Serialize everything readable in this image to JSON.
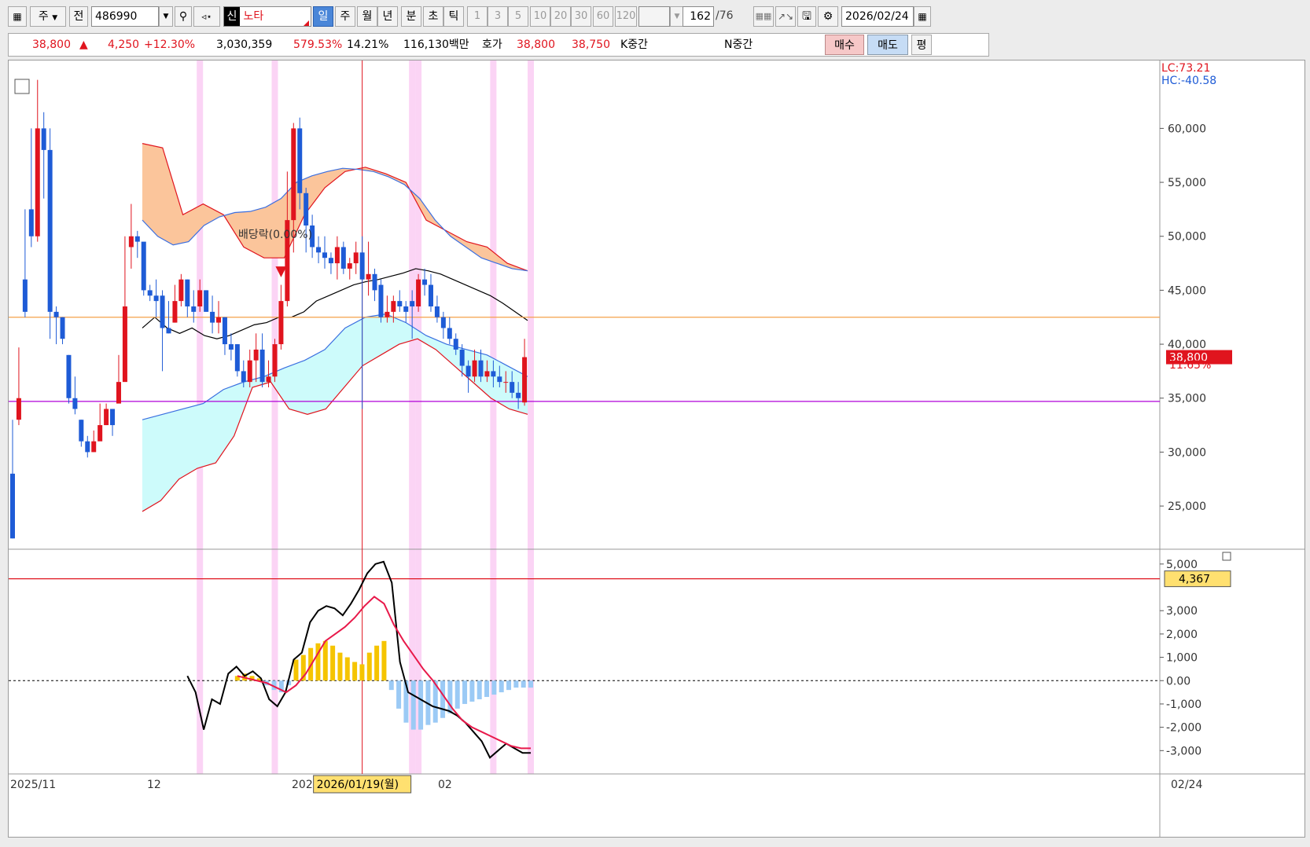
{
  "toolbar": {
    "market_type": "주",
    "market_mode": "전",
    "code": "486990",
    "credit_badge": "신",
    "stock_name": "노타",
    "period_buttons": [
      "일",
      "주",
      "월",
      "년",
      "분",
      "초",
      "틱"
    ],
    "active_period": "일",
    "minute_buttons": [
      "1",
      "3",
      "5",
      "10",
      "20",
      "30",
      "60",
      "120"
    ],
    "count": "162",
    "count_total": "/76",
    "date": "2026/02/24"
  },
  "quote": {
    "price": "38,800",
    "arrow": "▲",
    "change": "4,250",
    "change_pct": "+12.30%",
    "volume": "3,030,359",
    "volume_ratio": "579.53%",
    "turnover": "14.21%",
    "amount": "116,130백만",
    "hoga_label": "호가",
    "ask": "38,800",
    "bid": "38,750",
    "k_label": "K중간",
    "n_label": "N중간",
    "buy_label": "매수",
    "sell_label": "매도",
    "eval_label": "평"
  },
  "chart_data": [
    {
      "type": "candlestick",
      "title": "",
      "ylim": [
        21000,
        66000
      ],
      "y_ticks": [
        25000,
        30000,
        35000,
        40000,
        45000,
        50000,
        55000,
        60000
      ],
      "y_tick_labels": [
        "25,000",
        "30,000",
        "35,000",
        "40,000",
        "45,000",
        "50,000",
        "55,000",
        "60,000"
      ],
      "x_labels": [
        "2025/11",
        "12",
        "2026/01",
        "02",
        "02/24"
      ],
      "crosshair_date": "2026/01/19(월)",
      "lc_label": "LC:73.21",
      "hc_label": "HC:-40.58",
      "last_price_label": "38,800",
      "last_pct_label": "11.65%",
      "annotation": "배당락(0.00%)",
      "hlines": [
        42500,
        34700
      ],
      "candles": [
        [
          28000,
          22000,
          22000,
          33000
        ],
        [
          33000,
          35000,
          32500,
          39700
        ],
        [
          46000,
          43000,
          42500,
          52500
        ],
        [
          52500,
          50000,
          49000,
          60000
        ],
        [
          50000,
          60000,
          49500,
          64500
        ],
        [
          60000,
          58000,
          53500,
          61500
        ],
        [
          58000,
          43000,
          40500,
          60000
        ],
        [
          43000,
          42500,
          40000,
          43500
        ],
        [
          42500,
          40500,
          40000,
          42500
        ],
        [
          39000,
          35000,
          34500,
          39000
        ],
        [
          35000,
          34000,
          33500,
          37000
        ],
        [
          33000,
          31000,
          30500,
          33000
        ],
        [
          31000,
          30000,
          29500,
          31500
        ],
        [
          30000,
          31000,
          30000,
          32000
        ],
        [
          31000,
          32500,
          31500,
          34500
        ],
        [
          32500,
          34000,
          32500,
          34500
        ],
        [
          34000,
          32500,
          31500,
          34000
        ],
        [
          34500,
          36500,
          35500,
          39000
        ],
        [
          36500,
          43500,
          38500,
          50000
        ],
        [
          49000,
          50000,
          47000,
          53000
        ],
        [
          50000,
          49500,
          48000,
          50500
        ],
        [
          49500,
          45000,
          44500,
          48000
        ],
        [
          45000,
          44500,
          44000,
          45500
        ],
        [
          44500,
          44000,
          42500,
          46000
        ],
        [
          44500,
          41500,
          37500,
          45000
        ],
        [
          41500,
          41000,
          41000,
          44000
        ],
        [
          42000,
          44000,
          42000,
          45500
        ],
        [
          44000,
          46000,
          43500,
          46500
        ],
        [
          46000,
          43500,
          42500,
          46000
        ],
        [
          43500,
          43000,
          42000,
          45000
        ],
        [
          43500,
          45000,
          43000,
          46000
        ],
        [
          45000,
          43000,
          43000,
          45000
        ],
        [
          43000,
          42000,
          41000,
          44500
        ],
        [
          42000,
          42500,
          41000,
          44000
        ],
        [
          42500,
          40000,
          39000,
          42500
        ],
        [
          40000,
          39500,
          38500,
          41000
        ],
        [
          40000,
          37500,
          37000,
          40000
        ],
        [
          37500,
          36500,
          36000,
          38500
        ],
        [
          36500,
          38500,
          36000,
          39500
        ],
        [
          38500,
          39500,
          36500,
          41000
        ],
        [
          39500,
          36500,
          36000,
          41000
        ],
        [
          36500,
          37000,
          36000,
          38500
        ],
        [
          37000,
          40000,
          36500,
          40500
        ],
        [
          40000,
          44000,
          39500,
          45500
        ],
        [
          44000,
          51500,
          43500,
          56000
        ],
        [
          51500,
          60000,
          48500,
          60500
        ],
        [
          60000,
          54000,
          52500,
          61000
        ],
        [
          54000,
          51000,
          48500,
          54500
        ],
        [
          51000,
          49000,
          48000,
          52000
        ],
        [
          49000,
          48500,
          47500,
          50000
        ],
        [
          48500,
          48000,
          47000,
          50000
        ],
        [
          48000,
          47500,
          46500,
          48500
        ],
        [
          47500,
          49000,
          46000,
          50000
        ],
        [
          49000,
          47000,
          46500,
          49500
        ],
        [
          47000,
          47500,
          46000,
          48000
        ],
        [
          47500,
          48500,
          46500,
          49500
        ],
        [
          48500,
          46000,
          34000,
          50000
        ],
        [
          46000,
          46500,
          44500,
          49500
        ],
        [
          46500,
          45000,
          44000,
          47000
        ],
        [
          45500,
          42500,
          42000,
          46000
        ],
        [
          42500,
          43000,
          42000,
          44500
        ],
        [
          43000,
          44000,
          42000,
          44500
        ],
        [
          44000,
          43500,
          43000,
          45000
        ],
        [
          43500,
          43000,
          42000,
          44000
        ],
        [
          44000,
          43500,
          40500,
          45000
        ],
        [
          43500,
          46000,
          43000,
          46500
        ],
        [
          46000,
          45500,
          44500,
          47000
        ],
        [
          45500,
          43500,
          43000,
          46500
        ],
        [
          43500,
          42500,
          42000,
          44500
        ],
        [
          42500,
          41500,
          40500,
          43000
        ],
        [
          41500,
          40500,
          40000,
          42500
        ],
        [
          40500,
          39500,
          39000,
          41000
        ],
        [
          39500,
          38000,
          37000,
          40000
        ],
        [
          38000,
          37000,
          35500,
          38500
        ],
        [
          37000,
          38500,
          36500,
          39500
        ],
        [
          38500,
          37000,
          36500,
          39500
        ],
        [
          37000,
          37500,
          36500,
          38500
        ],
        [
          37500,
          37000,
          36000,
          38500
        ],
        [
          37000,
          36500,
          36000,
          38000
        ],
        [
          36500,
          36500,
          35500,
          37500
        ],
        [
          36500,
          35500,
          35000,
          37500
        ],
        [
          35500,
          35000,
          34000,
          36500
        ],
        [
          34600,
          38800,
          34300,
          40500
        ]
      ],
      "bollinger_mid": [
        41500,
        42500,
        41500,
        41000,
        41500,
        40800,
        40500,
        40800,
        41300,
        41800,
        42000,
        42500,
        42500,
        43000,
        44000,
        44500,
        45000,
        45500,
        45800,
        46000,
        46300,
        46600,
        47000,
        46800,
        46500,
        46000,
        45500,
        45000,
        44500,
        43800,
        43000,
        42200
      ],
      "bollinger_upper": [
        51500,
        50000,
        49200,
        49500,
        51000,
        51800,
        52200,
        52300,
        52700,
        53500,
        55000,
        55600,
        56000,
        56300,
        56200,
        56000,
        55500,
        54800,
        53500,
        51500,
        50000,
        49000,
        48000,
        47500,
        47000,
        46800
      ],
      "bollinger_lower_band": [
        27000,
        29000,
        28500,
        29000,
        30500,
        31500,
        33000,
        35000,
        35500,
        35500,
        36000,
        36500,
        37500,
        38500,
        39000,
        40500,
        40800,
        40200,
        39200,
        38500,
        37500,
        37000
      ],
      "upper_cloud_top": [
        58600,
        58200,
        52000,
        53000,
        52000,
        49000,
        48000,
        48000,
        52000,
        54500,
        56000,
        56400,
        55800,
        55000,
        51500,
        50500,
        49500,
        49000,
        47500,
        46800
      ],
      "upper_cloud_bottom": [
        51500,
        50000,
        49200,
        49500,
        51000,
        51800,
        52200,
        52300,
        52700,
        53500,
        55000,
        55600,
        56000,
        56300,
        56200,
        56000,
        55500,
        54800,
        53500,
        51500,
        50000,
        49000,
        48000,
        47500,
        47000,
        46800
      ],
      "lower_cloud_top": [
        33000,
        33500,
        34000,
        34500,
        35800,
        36500,
        37000,
        37800,
        38500,
        39500,
        41500,
        42500,
        42800,
        42000,
        40800,
        40000,
        39500,
        39000,
        38000,
        37000
      ],
      "lower_cloud_bottom": [
        24500,
        25500,
        27500,
        28500,
        29000,
        31500,
        36000,
        36500,
        34000,
        33500,
        34000,
        36000,
        38000,
        39000,
        40000,
        40500,
        39500,
        38000,
        36500,
        35000,
        34000,
        33500
      ]
    },
    {
      "type": "macd",
      "ylim": [
        -4000,
        5500
      ],
      "y_ticks": [
        5000,
        3000,
        2000,
        1000,
        0,
        -1000,
        -2000,
        -3000
      ],
      "y_tick_labels": [
        "5,000",
        "3,000",
        "2,000",
        "1,000",
        "0.00",
        "-1,000",
        "-2,000",
        "-3,000"
      ],
      "current_value_label": "4,367",
      "hline": 4367,
      "macd_line": [
        200,
        -500,
        -2100,
        -800,
        -1000,
        300,
        600,
        200,
        400,
        100,
        -800,
        -1100,
        -500,
        900,
        1200,
        2500,
        3000,
        3200,
        3100,
        2800,
        3300,
        3900,
        4600,
        5000,
        5100,
        4200,
        800,
        -500,
        -700,
        -900,
        -1100,
        -1200,
        -1300,
        -1500,
        -1800,
        -2200,
        -2600,
        -3300,
        -3000,
        -2700,
        -2900,
        -3100,
        -3100
      ],
      "signal_line": [
        200,
        100,
        0,
        -100,
        -300,
        -500,
        -200,
        300,
        1000,
        1700,
        2000,
        2300,
        2700,
        3200,
        3600,
        3300,
        2400,
        1700,
        1100,
        500,
        0,
        -600,
        -1200,
        -1700,
        -2000,
        -2200,
        -2400,
        -2600,
        -2800,
        -2900,
        -2900
      ],
      "histogram": [
        200,
        300,
        200,
        100,
        -200,
        -400,
        -500,
        -200,
        900,
        1100,
        1400,
        1600,
        1700,
        1500,
        1200,
        1000,
        800,
        700,
        1200,
        1500,
        1700,
        -400,
        -1200,
        -1800,
        -2100,
        -2100,
        -1900,
        -1800,
        -1600,
        -1400,
        -1200,
        -1000,
        -900,
        -800,
        -700,
        -600,
        -500,
        -400,
        -300,
        -300,
        -300
      ]
    }
  ]
}
